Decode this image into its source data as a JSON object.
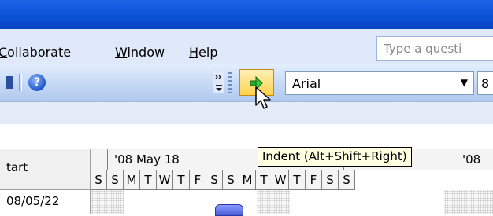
{
  "menubar": {
    "items": [
      {
        "prefix": "",
        "accel": "C",
        "rest": "ollaborate"
      },
      {
        "prefix": "",
        "accel": "W",
        "rest": "indow"
      },
      {
        "prefix": "",
        "accel": "H",
        "rest": "elp"
      }
    ],
    "ask_placeholder": "Type a questi"
  },
  "toolbar": {
    "help_glyph": "?",
    "font_name": "Arial",
    "font_size": "8"
  },
  "tooltip": "Indent (Alt+Shift+Right)",
  "gantt": {
    "start_header": "tart",
    "week1_label": "'08 May 18",
    "week2_label": "'08",
    "days": [
      "S",
      "S",
      "M",
      "T",
      "W",
      "T",
      "F",
      "S",
      "S",
      "M",
      "T",
      "W",
      "T",
      "F",
      "S",
      "S"
    ],
    "row1_date": "08/05/22"
  }
}
